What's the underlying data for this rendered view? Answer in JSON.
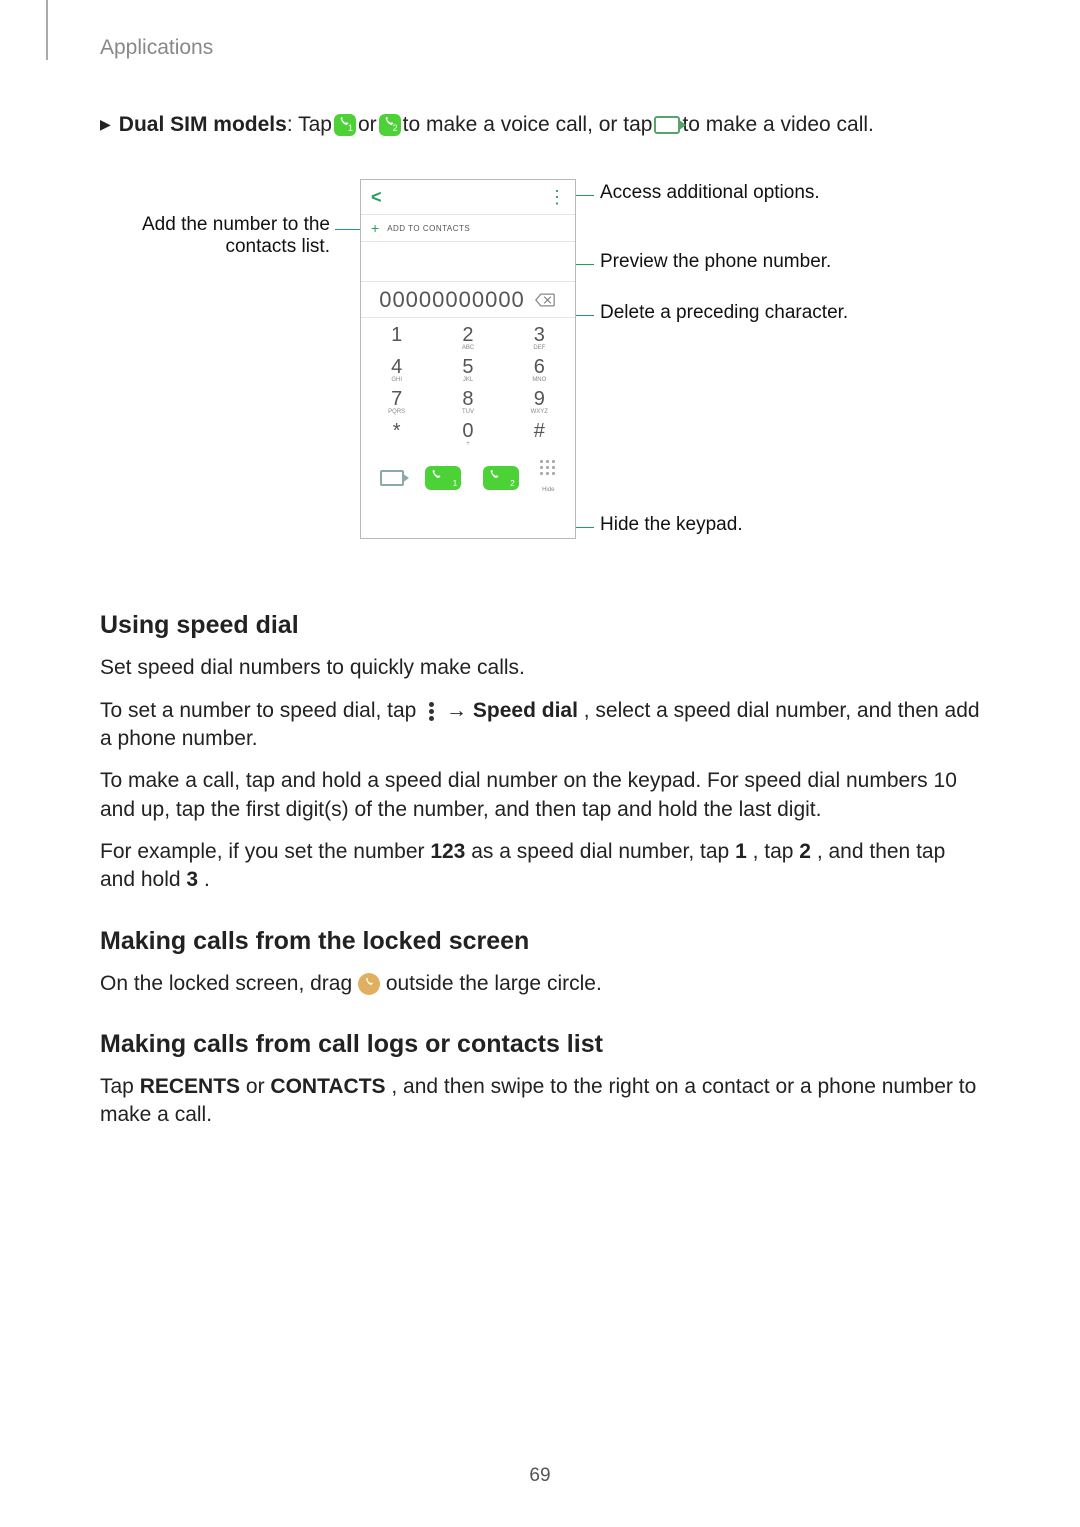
{
  "header": "Applications",
  "pageNumber": "69",
  "dualSim": {
    "prefix": "Dual SIM models",
    "tap": ": Tap ",
    "or": " or ",
    "voice": " to make a voice call, or tap ",
    "video": " to make a video call."
  },
  "callouts": {
    "addContacts": "Add the number to the contacts list.",
    "accessOptions": "Access additional options.",
    "preview": "Preview the phone number.",
    "delete": "Delete a preceding character.",
    "hideKeypad": "Hide the keypad."
  },
  "phone": {
    "addToContacts": "ADD TO CONTACTS",
    "number": "00000000000",
    "hide": "Hide",
    "keys": [
      [
        {
          "n": "1",
          "l": ""
        },
        {
          "n": "2",
          "l": "ABC"
        },
        {
          "n": "3",
          "l": "DEF"
        }
      ],
      [
        {
          "n": "4",
          "l": "GHI"
        },
        {
          "n": "5",
          "l": "JKL"
        },
        {
          "n": "6",
          "l": "MNO"
        }
      ],
      [
        {
          "n": "7",
          "l": "PQRS"
        },
        {
          "n": "8",
          "l": "TUV"
        },
        {
          "n": "9",
          "l": "WXYZ"
        }
      ],
      [
        {
          "n": "*",
          "l": ""
        },
        {
          "n": "0",
          "l": "+"
        },
        {
          "n": "#",
          "l": ""
        }
      ]
    ]
  },
  "sections": {
    "speedDial": {
      "title": "Using speed dial",
      "p1": "Set speed dial numbers to quickly make calls.",
      "p2a": "To set a number to speed dial, tap ",
      "p2b": " → ",
      "p2bold": "Speed dial",
      "p2c": ", select a speed dial number, and then add a phone number.",
      "p3": "To make a call, tap and hold a speed dial number on the keypad. For speed dial numbers 10 and up, tap the first digit(s) of the number, and then tap and hold the last digit.",
      "p4a": "For example, if you set the number ",
      "p4_123": "123",
      "p4b": " as a speed dial number, tap ",
      "p4_1": "1",
      "p4c": ", tap ",
      "p4_2": "2",
      "p4d": ", and then tap and hold ",
      "p4_3": "3",
      "p4e": "."
    },
    "locked": {
      "title": "Making calls from the locked screen",
      "p1a": "On the locked screen, drag ",
      "p1b": " outside the large circle."
    },
    "callLogs": {
      "title": "Making calls from call logs or contacts list",
      "p1a": "Tap ",
      "recents": "RECENTS",
      "or": " or ",
      "contacts": "CONTACTS",
      "p1b": ", and then swipe to the right on a contact or a phone number to make a call."
    }
  }
}
